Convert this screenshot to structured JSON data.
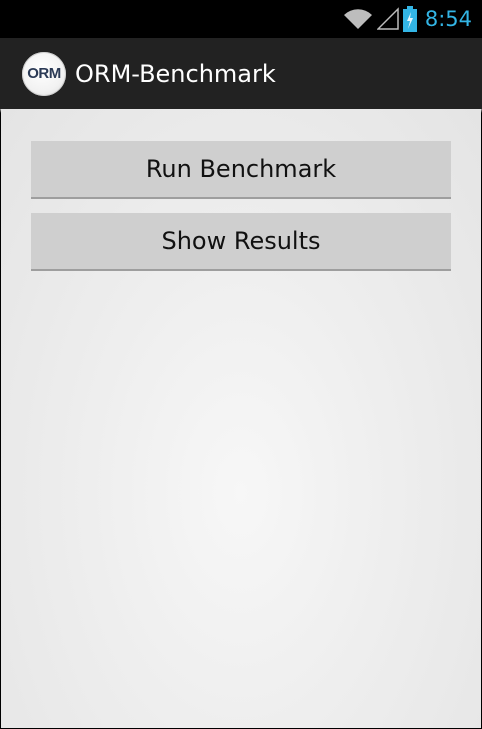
{
  "status_bar": {
    "time": "8:54",
    "icons": [
      "wifi-icon",
      "signal-icon",
      "battery-charging-icon"
    ],
    "time_color": "#33b5e5"
  },
  "action_bar": {
    "app_icon_text": "ORM",
    "title": "ORM-Benchmark"
  },
  "main": {
    "run_button_label": "Run Benchmark",
    "results_button_label": "Show Results"
  }
}
